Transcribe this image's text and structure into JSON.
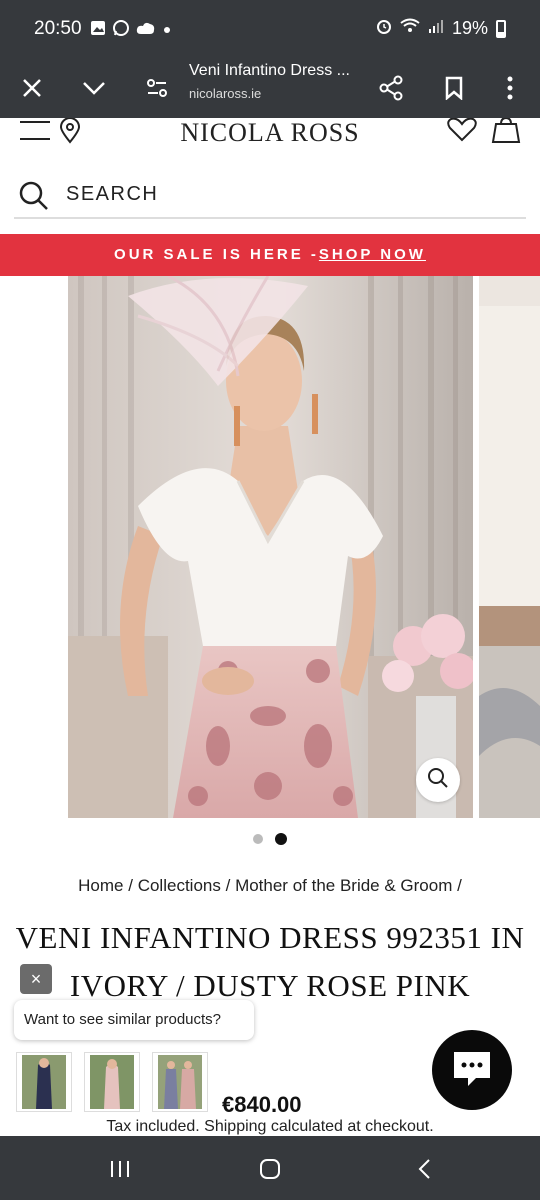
{
  "status_bar": {
    "time": "20:50",
    "battery": "19%",
    "icons": [
      "gallery-icon",
      "whatsapp-icon",
      "cloud-icon",
      "dot-icon",
      "alarm-icon",
      "wifi-icon",
      "signal-icon",
      "battery-icon"
    ]
  },
  "browser": {
    "title": "Veni Infantino Dress ...",
    "url": "nicolaross.ie",
    "actions": [
      "close-icon",
      "chevron-down-icon",
      "page-settings-icon",
      "share-icon",
      "bookmark-icon",
      "more-icon"
    ]
  },
  "site": {
    "logo": "NICOLA ROSS",
    "search_label": "SEARCH",
    "sale_text": "OUR SALE IS HERE -",
    "sale_link": "SHOP NOW"
  },
  "gallery": {
    "active_index": 1,
    "total": 2
  },
  "breadcrumb": {
    "home": "Home",
    "collections": "Collections",
    "category": "Mother of the Bride & Groom",
    "sep": "/"
  },
  "product": {
    "title": "VENI INFANTINO DRESS 992351 IN IVORY / DUSTY ROSE PINK",
    "price": "€840.00",
    "tax_note": "Tax included. Shipping calculated at checkout."
  },
  "widgets": {
    "similar_prompt": "Want to see similar products?",
    "close_label": "×"
  },
  "colors": {
    "sale_bar": "#e2333f",
    "system_bar": "#36393d"
  }
}
